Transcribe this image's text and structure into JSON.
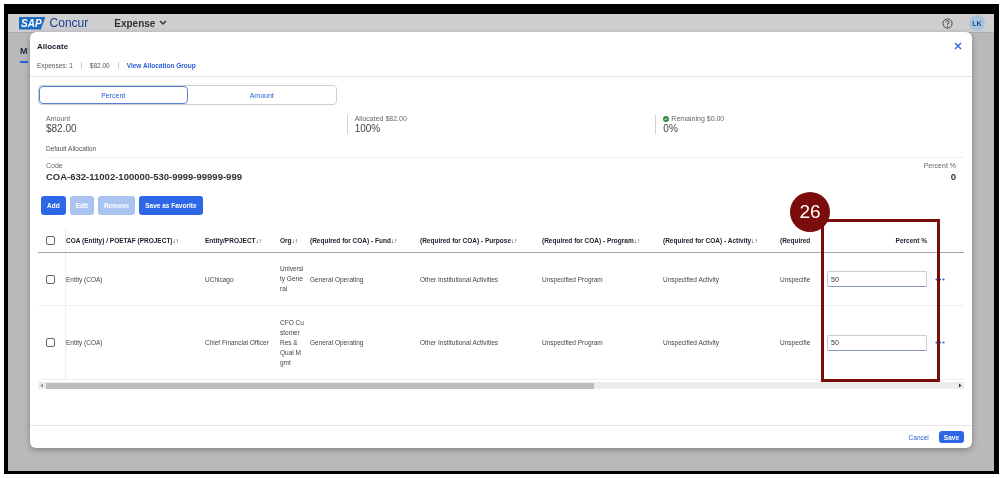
{
  "app_header": {
    "logo": {
      "mark": "SAP",
      "name": "Concur"
    },
    "menu": "Expense",
    "avatar": "LK"
  },
  "background_tab": "M",
  "dialog": {
    "title": "Allocate",
    "summary": {
      "expenses": "Expenses: 1",
      "total": "$82.00",
      "link": "View Allocation Group"
    },
    "mode_tabs": [
      {
        "label": "Percent",
        "selected": true
      },
      {
        "label": "Amount",
        "selected": false
      }
    ],
    "stats": [
      {
        "label": "Amount",
        "value": "$82.00",
        "complete": false
      },
      {
        "label": "Allocated $82.00",
        "value": "100%",
        "complete": false
      },
      {
        "label": "Remaining $0.00",
        "value": "0%",
        "complete": true
      }
    ],
    "default_allocation": {
      "heading": "Default Allocation",
      "code_label": "Code",
      "code": "COA-632-11002-100000-530-9999-99999-999",
      "percent_label": "Percent %",
      "percent": "0"
    },
    "actions": [
      {
        "label": "Add",
        "disabled": false
      },
      {
        "label": "Edit",
        "disabled": true
      },
      {
        "label": "Remove",
        "disabled": true
      },
      {
        "label": "Save as Favorite",
        "disabled": false
      }
    ],
    "table": {
      "all_selected": false,
      "columns": [
        "COA (Entity) / POETAF (PROJECT)↓↑",
        "Entity/PROJECT↓↑",
        "Org↓↑",
        "(Required for COA) - Fund↓↑",
        "(Required for COA) - Purpose↓↑",
        "(Required for COA) - Program↓↑",
        "(Required for COA) - Activity↓↑",
        "(Required",
        "Percent %"
      ],
      "rows": [
        {
          "selected": false,
          "cells": [
            "Entity (COA)",
            "UChicago",
            "University General",
            "General Operating",
            "Other Institutional Activities",
            "Unspecified Program",
            "Unspecified Activity",
            "Unspecifie"
          ],
          "percent": "50"
        },
        {
          "selected": false,
          "cells": [
            "Entity (COA)",
            "Chief Financial Officer",
            "CFO Customer Res & Qual Mgmt",
            "General Operating",
            "Other Institutional Activities",
            "Unspecified Program",
            "Unspecified Activity",
            "Unspecifie"
          ],
          "percent": "50"
        }
      ]
    },
    "footer": {
      "cancel": "Cancel",
      "save": "Save"
    }
  },
  "annotation": {
    "number": "26"
  }
}
